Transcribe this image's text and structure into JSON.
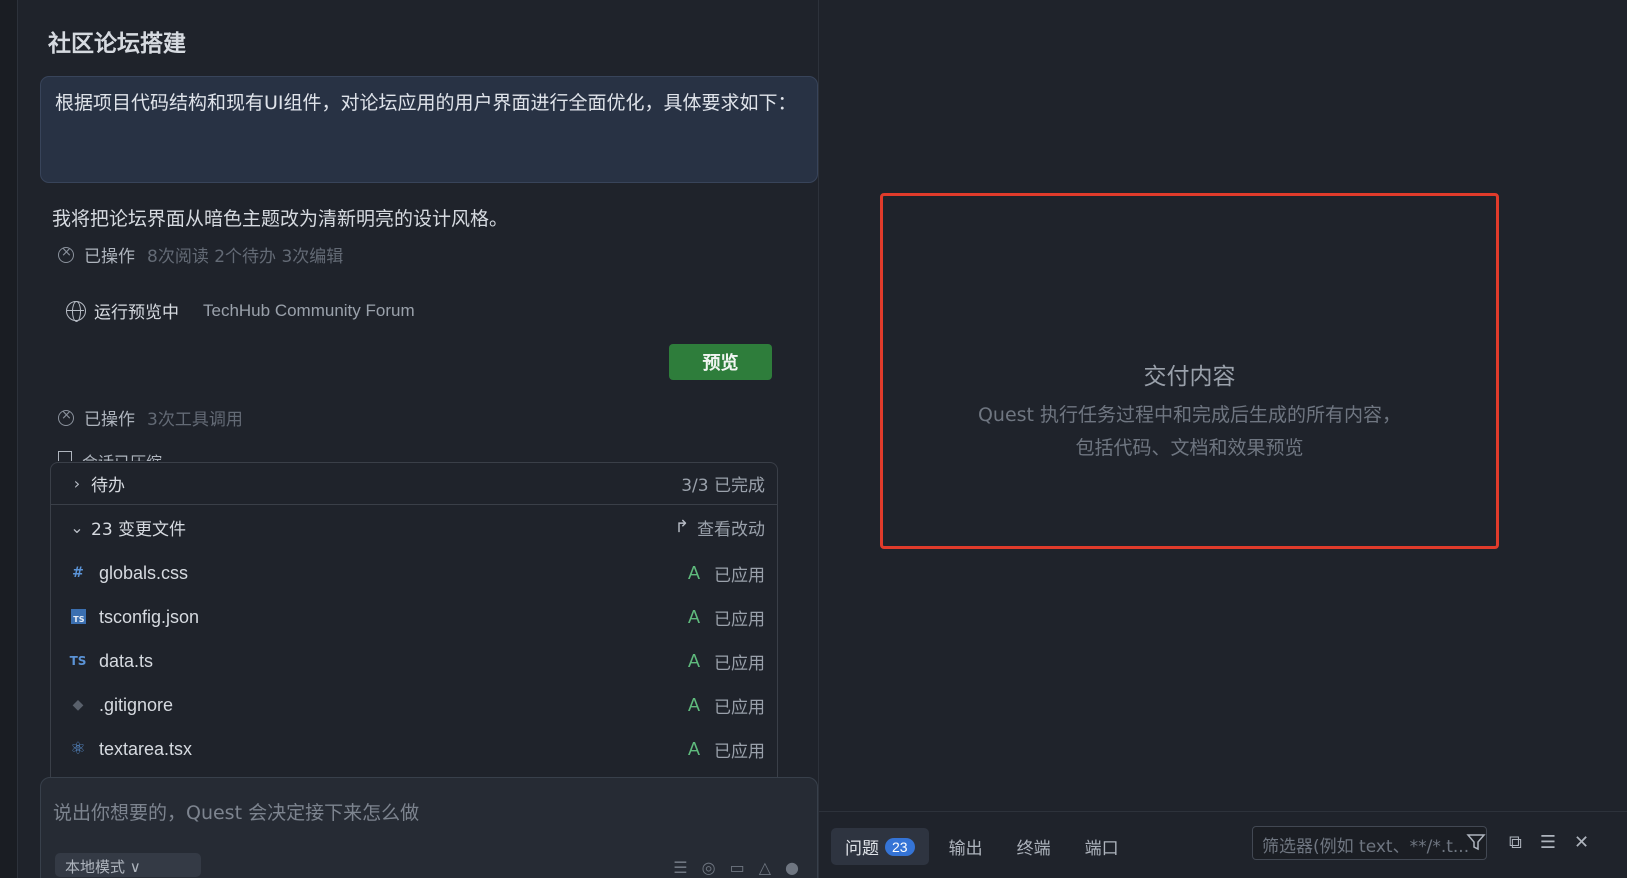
{
  "left": {
    "title": "社区论坛搭建",
    "prompt": "根据项目代码结构和现有UI组件，对论坛应用的用户界面进行全面优化，具体要求如下：",
    "reply": "我将把论坛界面从暗色主题改为清新明亮的设计风格。",
    "op1": {
      "label": "已操作",
      "meta": "8次阅读 2个待办 3次编辑"
    },
    "preview": {
      "status": "运行预览中",
      "site": "TechHub Community Forum",
      "button": "预览"
    },
    "op2": {
      "label": "已操作",
      "meta": "3次工具调用"
    },
    "compress": "会话已压缩",
    "todo": {
      "label": "待办",
      "progress": "3/3 已完成"
    },
    "changes": {
      "label": "23 变更文件",
      "view": "查看改动"
    },
    "files": [
      {
        "icon": "#",
        "name": "globals.css",
        "code": "A",
        "status": "已应用"
      },
      {
        "icon": "TS",
        "name": "tsconfig.json",
        "code": "A",
        "status": "已应用"
      },
      {
        "icon": "TS",
        "name": "data.ts",
        "code": "A",
        "status": "已应用"
      },
      {
        "icon": "◆",
        "name": ".gitignore",
        "code": "A",
        "status": "已应用"
      },
      {
        "icon": "⚛",
        "name": "textarea.tsx",
        "code": "A",
        "status": "已应用"
      }
    ],
    "input_placeholder": "说出你想要的，Quest 会决定接下来怎么做",
    "mode": "本地模式 ∨"
  },
  "right": {
    "deliver_title": "交付内容",
    "deliver_line1": "Quest 执行任务过程中和完成后生成的所有内容，",
    "deliver_line2": "包括代码、文档和效果预览",
    "tabs": {
      "problems": "问题",
      "problems_count": "23",
      "output": "输出",
      "terminal": "终端",
      "ports": "端口"
    },
    "filter_placeholder": "筛选器(例如 text、**/*.t..."
  },
  "colors": {
    "accent": "#3574d6",
    "preview_button": "#2e7d3b",
    "highlight_border": "#e03b2b",
    "added": "#5fba7d"
  }
}
